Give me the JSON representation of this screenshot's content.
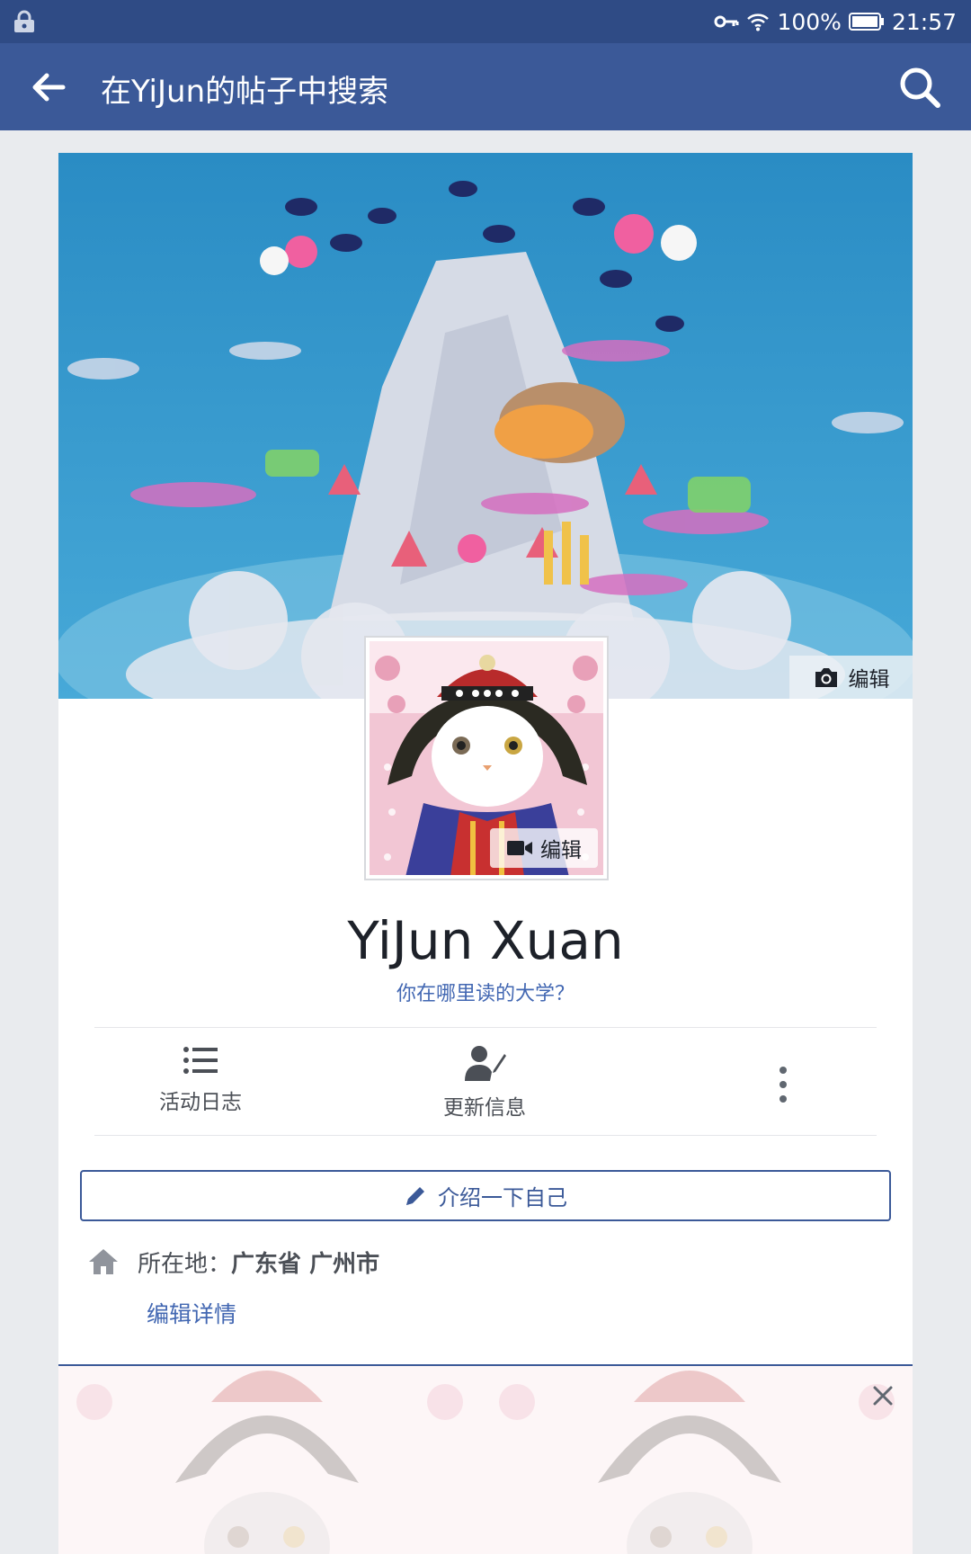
{
  "status_bar": {
    "battery": "100%",
    "time": "21:57",
    "icons": [
      "lock-icon",
      "key-icon",
      "wifi-icon",
      "battery-icon"
    ]
  },
  "app_bar": {
    "title": "在YiJun的帖子中搜索",
    "icons": [
      "back-arrow-icon",
      "search-icon"
    ]
  },
  "cover": {
    "edit_label": "编辑",
    "edit_icon": "camera-icon"
  },
  "avatar": {
    "edit_label": "编辑",
    "edit_icon": "video-camera-icon"
  },
  "profile": {
    "name": "YiJun Xuan",
    "college_prompt": "你在哪里读的大学？"
  },
  "actions": [
    {
      "label": "活动日志",
      "icon": "list-icon"
    },
    {
      "label": "更新信息",
      "icon": "edit-profile-icon"
    },
    {
      "label": "",
      "icon": "more-vertical-icon"
    }
  ],
  "intro_button": {
    "label": "介绍一下自己",
    "icon": "pencil-icon"
  },
  "location": {
    "label": "所在地：",
    "value": "广东省 广州市",
    "icon": "home-icon"
  },
  "edit_details": "编辑详情",
  "colors": {
    "brand_blue": "#3b5998",
    "status_bar": "#2f4b85",
    "link_blue": "#4267b2",
    "background": "#e9ebee"
  }
}
